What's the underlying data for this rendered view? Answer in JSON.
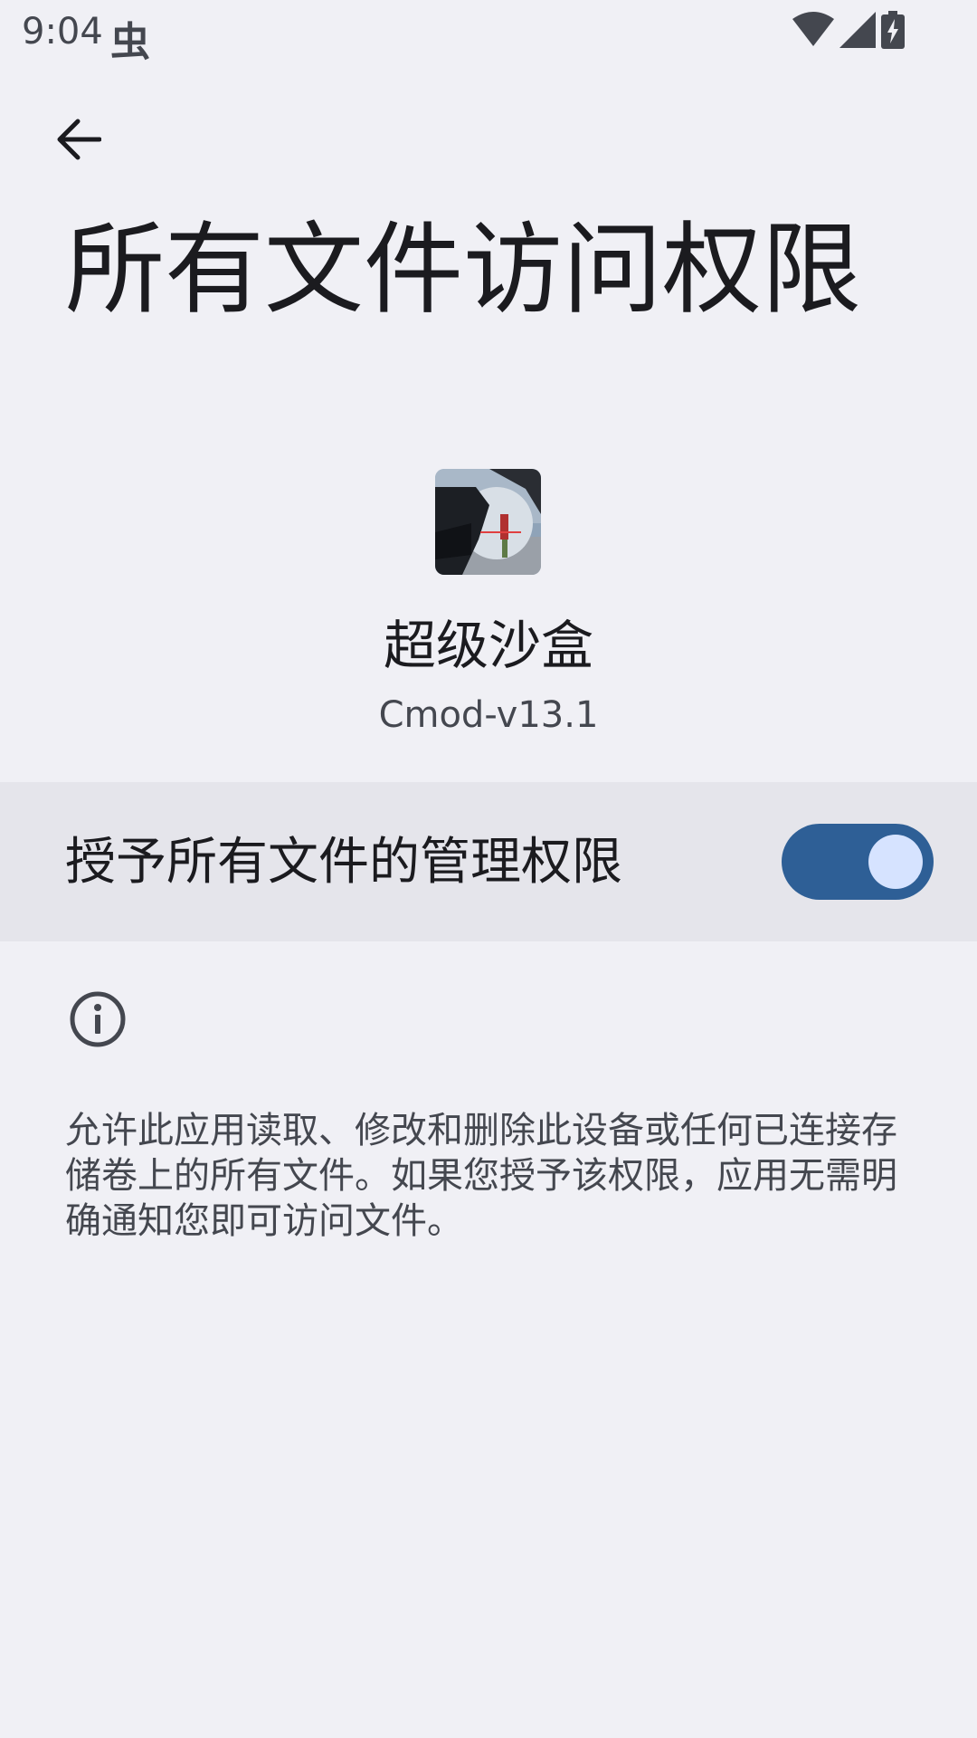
{
  "status_bar": {
    "time": "9:04",
    "debug_glyph": "虫",
    "icons": [
      "wifi-icon",
      "cell-signal-icon",
      "battery-charging-icon"
    ]
  },
  "toolbar": {
    "back_icon": "arrow-back-icon"
  },
  "page": {
    "title": "所有文件访问权限"
  },
  "app": {
    "name": "超级沙盒",
    "version": "Cmod-v13.1",
    "icon": "app-icon"
  },
  "permission": {
    "label": "授予所有文件的管理权限",
    "enabled": true
  },
  "info": {
    "icon": "info-icon",
    "description": "允许此应用读取、修改和删除此设备或任何已连接存储卷上的所有文件。如果您授予该权限，应用无需明确通知您即可访问文件。"
  },
  "colors": {
    "background": "#f0f0f5",
    "toggle_row_bg": "#e5e5eb",
    "switch_track": "#2e5f96",
    "switch_thumb": "#d6e3ff"
  }
}
